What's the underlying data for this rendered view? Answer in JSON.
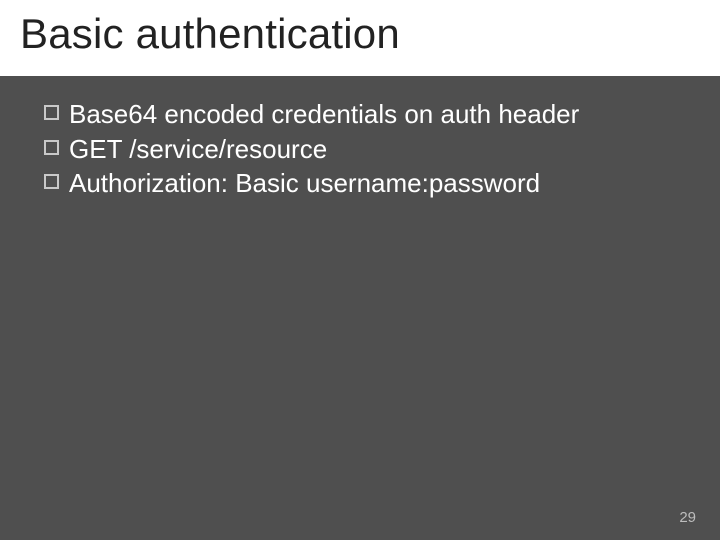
{
  "slide": {
    "title": "Basic authentication",
    "bullets": [
      {
        "text": "Base64 encoded credentials on auth header"
      },
      {
        "text": "GET /service/resource"
      },
      {
        "text": "Authorization: Basic username:password"
      }
    ],
    "page_number": "29"
  }
}
